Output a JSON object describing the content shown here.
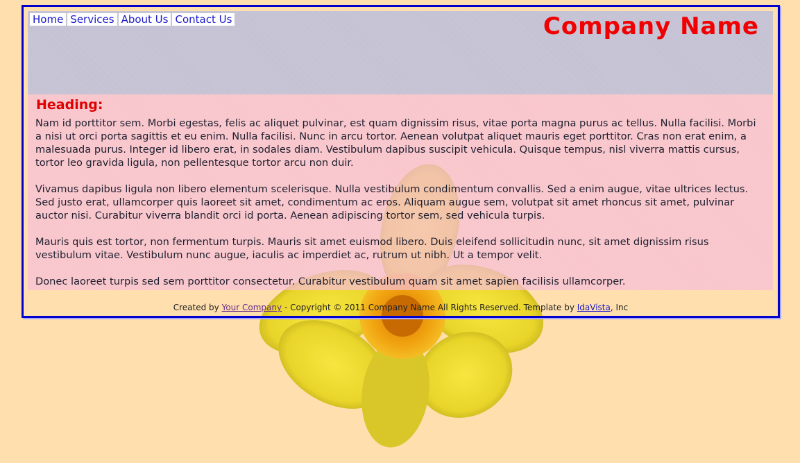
{
  "nav": {
    "items": [
      "Home",
      "Services",
      "About Us",
      "Contact Us"
    ]
  },
  "header": {
    "company_name": "Company Name"
  },
  "content": {
    "heading": "Heading:",
    "paragraphs": [
      "Nam id porttitor sem. Morbi egestas, felis ac aliquet pulvinar, est quam dignissim risus, vitae porta magna purus ac tellus. Nulla facilisi. Morbi a nisi ut orci porta sagittis et eu enim. Nulla facilisi. Nunc in arcu tortor. Aenean volutpat aliquet mauris eget porttitor. Cras non erat enim, a malesuada purus. Integer id libero erat, in sodales diam. Vestibulum dapibus suscipit vehicula. Quisque tempus, nisl viverra mattis cursus, tortor leo gravida ligula, non pellentesque tortor arcu non duir.",
      "Vivamus dapibus ligula non libero elementum scelerisque. Nulla vestibulum condimentum convallis. Sed a enim augue, vitae ultrices lectus. Sed justo erat, ullamcorper quis laoreet sit amet, condimentum ac eros. Aliquam augue sem, volutpat sit amet rhoncus sit amet, pulvinar auctor nisi. Curabitur viverra blandit orci id porta. Aenean adipiscing tortor sem, sed vehicula turpis.",
      "Mauris quis est tortor, non fermentum turpis. Mauris sit amet euismod libero. Duis eleifend sollicitudin nunc, sit amet dignissim risus vestibulum vitae. Vestibulum nunc augue, iaculis ac imperdiet ac, rutrum ut nibh. Ut a tempor velit.",
      "Donec laoreet turpis sed sem porttitor consectetur. Curabitur vestibulum quam sit amet sapien facilisis ullamcorper."
    ]
  },
  "footer": {
    "created_by": "Created by ",
    "your_company_link": "Your Company",
    "copyright": " - Copyright © 2011 Company Name All Rights Reserved.  Template by ",
    "idavista_link": "IdaVista",
    "suffix": ", Inc"
  },
  "colors": {
    "background": "#ffdfae",
    "border": "#0000cc",
    "company_name": "#f00000",
    "heading": "#e00000",
    "link": "#1a1acc"
  }
}
